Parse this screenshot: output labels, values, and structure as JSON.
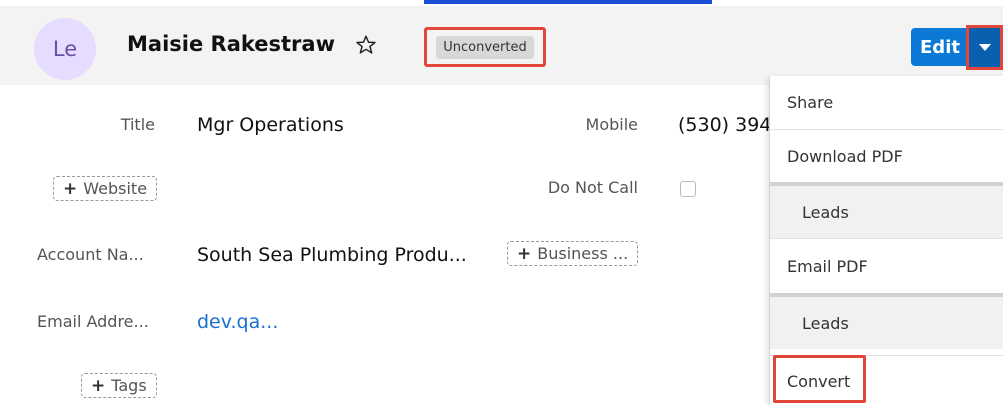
{
  "header": {
    "avatar_initials": "Le",
    "record_name": "Maisie Rakestraw",
    "status_badge": "Unconverted",
    "edit_label": "Edit"
  },
  "fields": {
    "title_label": "Title",
    "title_value": "Mgr Operations",
    "mobile_label": "Mobile",
    "mobile_value": "(530) 394",
    "website_chip": "Website",
    "do_not_call_label": "Do Not Call",
    "account_name_label": "Account Na...",
    "account_name_value": "South Sea Plumbing Produ...",
    "business_chip": "Business ...",
    "email_label": "Email Addre...",
    "email_value": "dev.qa...",
    "tags_chip": "Tags"
  },
  "dropdown": {
    "items": [
      {
        "label": "Share"
      },
      {
        "label": "Download PDF"
      },
      {
        "label": "Leads"
      },
      {
        "label": "Email PDF"
      },
      {
        "label": "Leads"
      },
      {
        "label": "Convert"
      }
    ]
  },
  "colors": {
    "accent": "#0d79d6",
    "highlight": "#e2453a",
    "avatar_bg": "#e5dcff"
  }
}
